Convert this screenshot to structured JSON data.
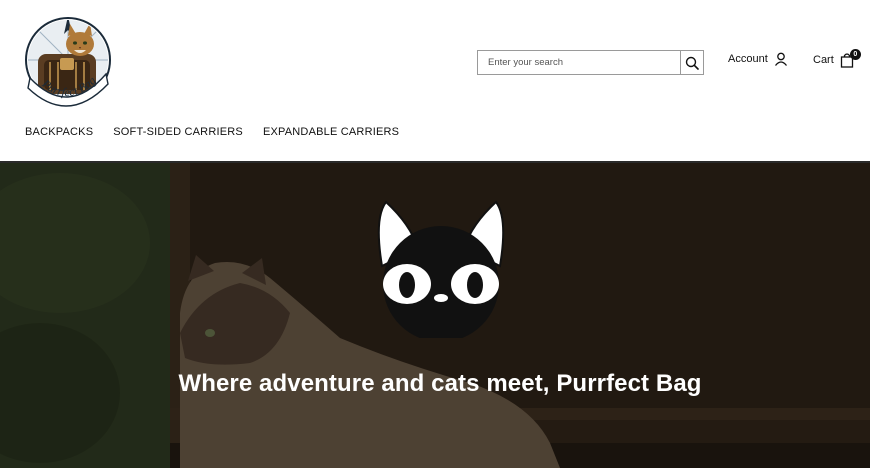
{
  "brand": {
    "logo_text": "Purrfect Bag"
  },
  "search": {
    "placeholder": "Enter your search"
  },
  "header": {
    "account_label": "Account",
    "cart_label": "Cart",
    "cart_count": "0"
  },
  "nav": {
    "items": [
      {
        "label": "BACKPACKS"
      },
      {
        "label": "SOFT-SIDED CARRIERS"
      },
      {
        "label": "EXPANDABLE CARRIERS"
      }
    ]
  },
  "hero": {
    "title": "Where adventure and cats meet, Purrfect Bag"
  },
  "icons": {
    "search": "search-icon",
    "account": "user-icon",
    "cart": "shopping-bag-icon",
    "hero_mark": "black-cat-face-icon"
  },
  "colors": {
    "text": "#111111",
    "hero_overlay": "#1a140f",
    "border": "#9a9a9a"
  }
}
